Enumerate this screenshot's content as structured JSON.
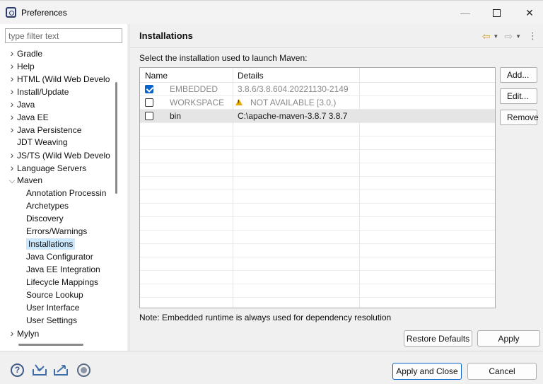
{
  "window": {
    "title": "Preferences"
  },
  "filter": {
    "placeholder": "type filter text"
  },
  "tree": {
    "items": [
      {
        "label": "Gradle",
        "expandable": true,
        "expanded": false,
        "level": 0
      },
      {
        "label": "Help",
        "expandable": true,
        "expanded": false,
        "level": 0
      },
      {
        "label": "HTML (Wild Web Develo",
        "expandable": true,
        "expanded": false,
        "level": 0
      },
      {
        "label": "Install/Update",
        "expandable": true,
        "expanded": false,
        "level": 0
      },
      {
        "label": "Java",
        "expandable": true,
        "expanded": false,
        "level": 0
      },
      {
        "label": "Java EE",
        "expandable": true,
        "expanded": false,
        "level": 0
      },
      {
        "label": "Java Persistence",
        "expandable": true,
        "expanded": false,
        "level": 0
      },
      {
        "label": "JDT Weaving",
        "expandable": false,
        "expanded": false,
        "level": 0
      },
      {
        "label": "JS/TS (Wild Web Develo",
        "expandable": true,
        "expanded": false,
        "level": 0
      },
      {
        "label": "Language Servers",
        "expandable": true,
        "expanded": false,
        "level": 0
      },
      {
        "label": "Maven",
        "expandable": true,
        "expanded": true,
        "level": 0
      },
      {
        "label": "Annotation Processin",
        "expandable": false,
        "expanded": false,
        "level": 1
      },
      {
        "label": "Archetypes",
        "expandable": false,
        "expanded": false,
        "level": 1
      },
      {
        "label": "Discovery",
        "expandable": false,
        "expanded": false,
        "level": 1
      },
      {
        "label": "Errors/Warnings",
        "expandable": false,
        "expanded": false,
        "level": 1
      },
      {
        "label": "Installations",
        "expandable": false,
        "expanded": false,
        "level": 1,
        "selected": true
      },
      {
        "label": "Java Configurator",
        "expandable": false,
        "expanded": false,
        "level": 1
      },
      {
        "label": "Java EE Integration",
        "expandable": false,
        "expanded": false,
        "level": 1
      },
      {
        "label": "Lifecycle Mappings",
        "expandable": false,
        "expanded": false,
        "level": 1
      },
      {
        "label": "Source Lookup",
        "expandable": false,
        "expanded": false,
        "level": 1
      },
      {
        "label": "User Interface",
        "expandable": false,
        "expanded": false,
        "level": 1
      },
      {
        "label": "User Settings",
        "expandable": false,
        "expanded": false,
        "level": 1
      },
      {
        "label": "Mylyn",
        "expandable": true,
        "expanded": false,
        "level": 0
      }
    ]
  },
  "page": {
    "title": "Installations",
    "instruction": "Select the installation used to launch Maven:",
    "note": "Note: Embedded runtime is always used for dependency resolution"
  },
  "table": {
    "columns": [
      "Name",
      "Details"
    ],
    "rows": [
      {
        "checked": true,
        "name": "EMBEDDED",
        "details": "3.8.6/3.8.604.20221130-2149",
        "gray": true,
        "warning": false,
        "selected": false
      },
      {
        "checked": false,
        "name": "WORKSPACE",
        "details": "NOT AVAILABLE [3.0,)",
        "gray": true,
        "warning": true,
        "selected": false
      },
      {
        "checked": false,
        "name": "bin",
        "details": "C:\\apache-maven-3.8.7 3.8.7",
        "gray": false,
        "warning": false,
        "selected": true
      }
    ]
  },
  "buttons": {
    "add": "Add...",
    "edit": "Edit...",
    "remove": "Remove",
    "restore_defaults": "Restore Defaults",
    "apply": "Apply",
    "apply_and_close": "Apply and Close",
    "cancel": "Cancel"
  },
  "colors": {
    "selection": "#cce8ff",
    "accent": "#0a63c9",
    "warning": "#e8a800"
  }
}
